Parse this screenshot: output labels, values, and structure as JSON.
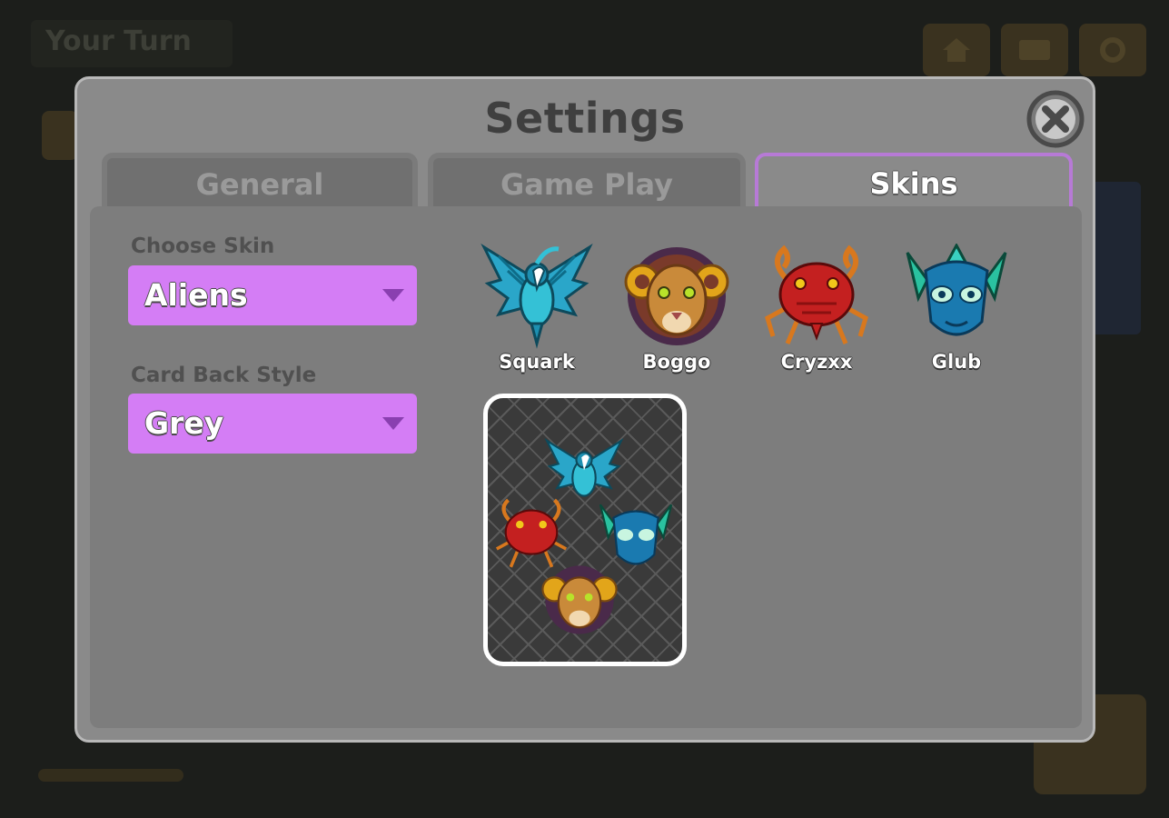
{
  "background": {
    "turn_label": "Your Turn"
  },
  "modal": {
    "title": "Settings",
    "close_icon": "close-icon",
    "tabs": [
      {
        "label": "General",
        "active": false
      },
      {
        "label": "Game Play",
        "active": false
      },
      {
        "label": "Skins",
        "active": true
      }
    ]
  },
  "skins_panel": {
    "choose_skin_label": "Choose Skin",
    "choose_skin_value": "Aliens",
    "card_back_label": "Card Back Style",
    "card_back_value": "Grey",
    "skins": [
      {
        "name": "Squark",
        "icon": "bird-alien-icon"
      },
      {
        "name": "Boggo",
        "icon": "lion-alien-icon"
      },
      {
        "name": "Cryzxx",
        "icon": "crab-alien-icon"
      },
      {
        "name": "Glub",
        "icon": "fish-alien-icon"
      }
    ]
  },
  "colors": {
    "dropdown_bg": "#d47df5",
    "active_tab_border": "#b77ad6",
    "modal_bg": "#8a8a8a",
    "panel_bg": "#7d7d7d"
  }
}
